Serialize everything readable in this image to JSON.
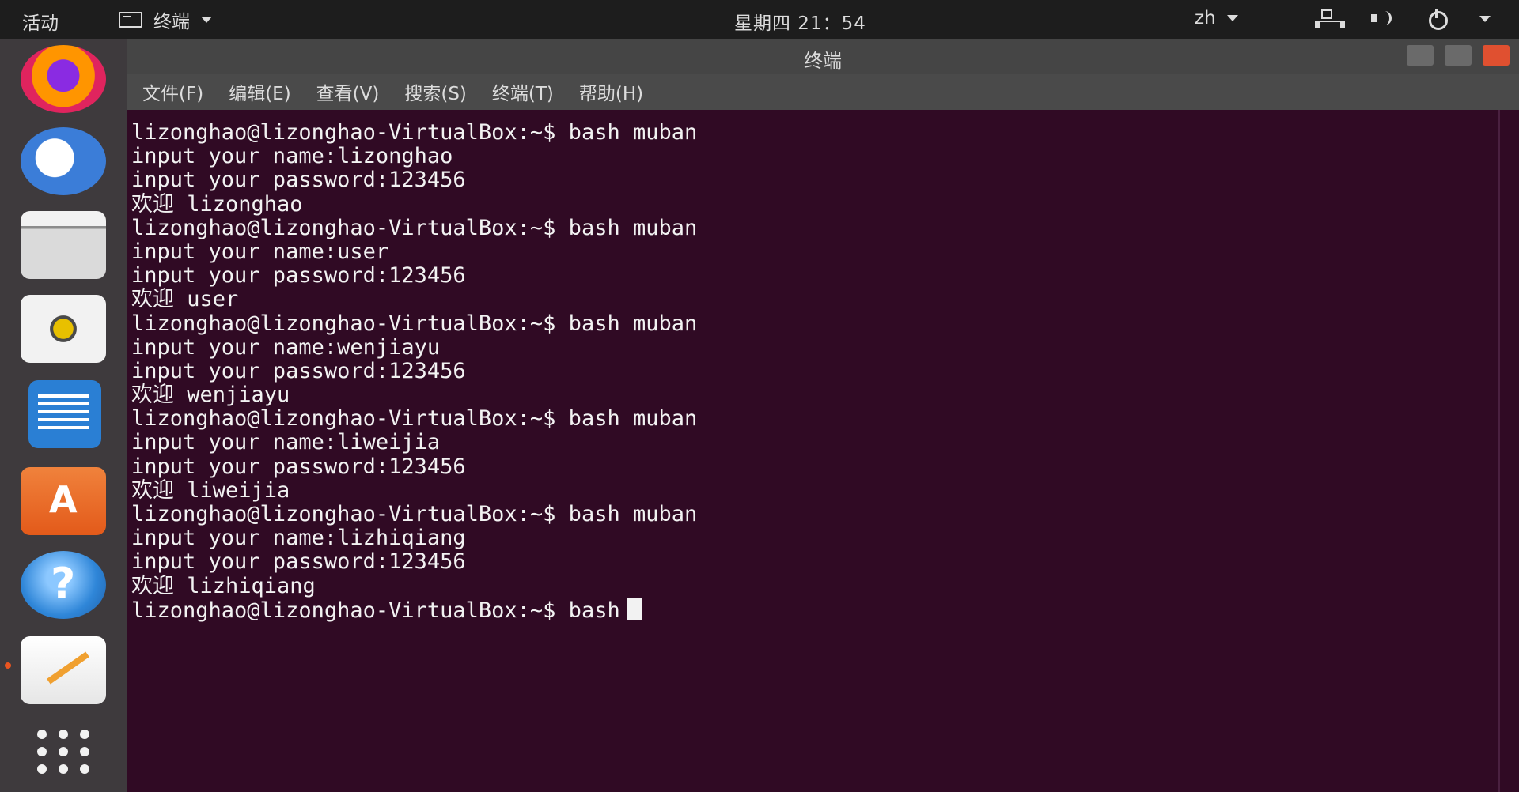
{
  "topbar": {
    "activities_label": "活动",
    "app_menu_label": "终端",
    "clock": "星期四 21：54",
    "input_method": "zh"
  },
  "dock": {
    "items": [
      {
        "name": "firefox",
        "icon": "firefox-icon"
      },
      {
        "name": "thunderbird",
        "icon": "thunderbird-icon"
      },
      {
        "name": "files",
        "icon": "files-icon"
      },
      {
        "name": "rhythmbox",
        "icon": "rhythmbox-icon"
      },
      {
        "name": "libreoffice-writer",
        "icon": "writer-icon"
      },
      {
        "name": "ubuntu-software",
        "icon": "software-icon"
      },
      {
        "name": "help",
        "icon": "help-icon"
      },
      {
        "name": "text-editor",
        "icon": "editor-icon"
      },
      {
        "name": "show-applications",
        "icon": "apps-grid-icon"
      }
    ]
  },
  "window": {
    "title": "终端",
    "menu": {
      "file": "文件(F)",
      "edit": "编辑(E)",
      "view": "查看(V)",
      "search": "搜索(S)",
      "terminal": "终端(T)",
      "help": "帮助(H)"
    }
  },
  "terminal": {
    "lines": [
      "lizonghao@lizonghao-VirtualBox:~$ bash muban",
      "input your name:lizonghao",
      "input your password:123456",
      "欢迎 lizonghao",
      "lizonghao@lizonghao-VirtualBox:~$ bash muban",
      "input your name:user",
      "input your password:123456",
      "欢迎 user",
      "lizonghao@lizonghao-VirtualBox:~$ bash muban",
      "input your name:wenjiayu",
      "input your password:123456",
      "欢迎 wenjiayu",
      "lizonghao@lizonghao-VirtualBox:~$ bash muban",
      "input your name:liweijia",
      "input your password:123456",
      "欢迎 liweijia",
      "lizonghao@lizonghao-VirtualBox:~$ bash muban",
      "input your name:lizhiqiang",
      "input your password:123456",
      "欢迎 lizhiqiang"
    ],
    "current_prompt": "lizonghao@lizonghao-VirtualBox:~$ bash"
  },
  "colors": {
    "terminal_bg": "#300a24",
    "terminal_fg": "#f2f2f2",
    "close_button": "#e05030"
  }
}
